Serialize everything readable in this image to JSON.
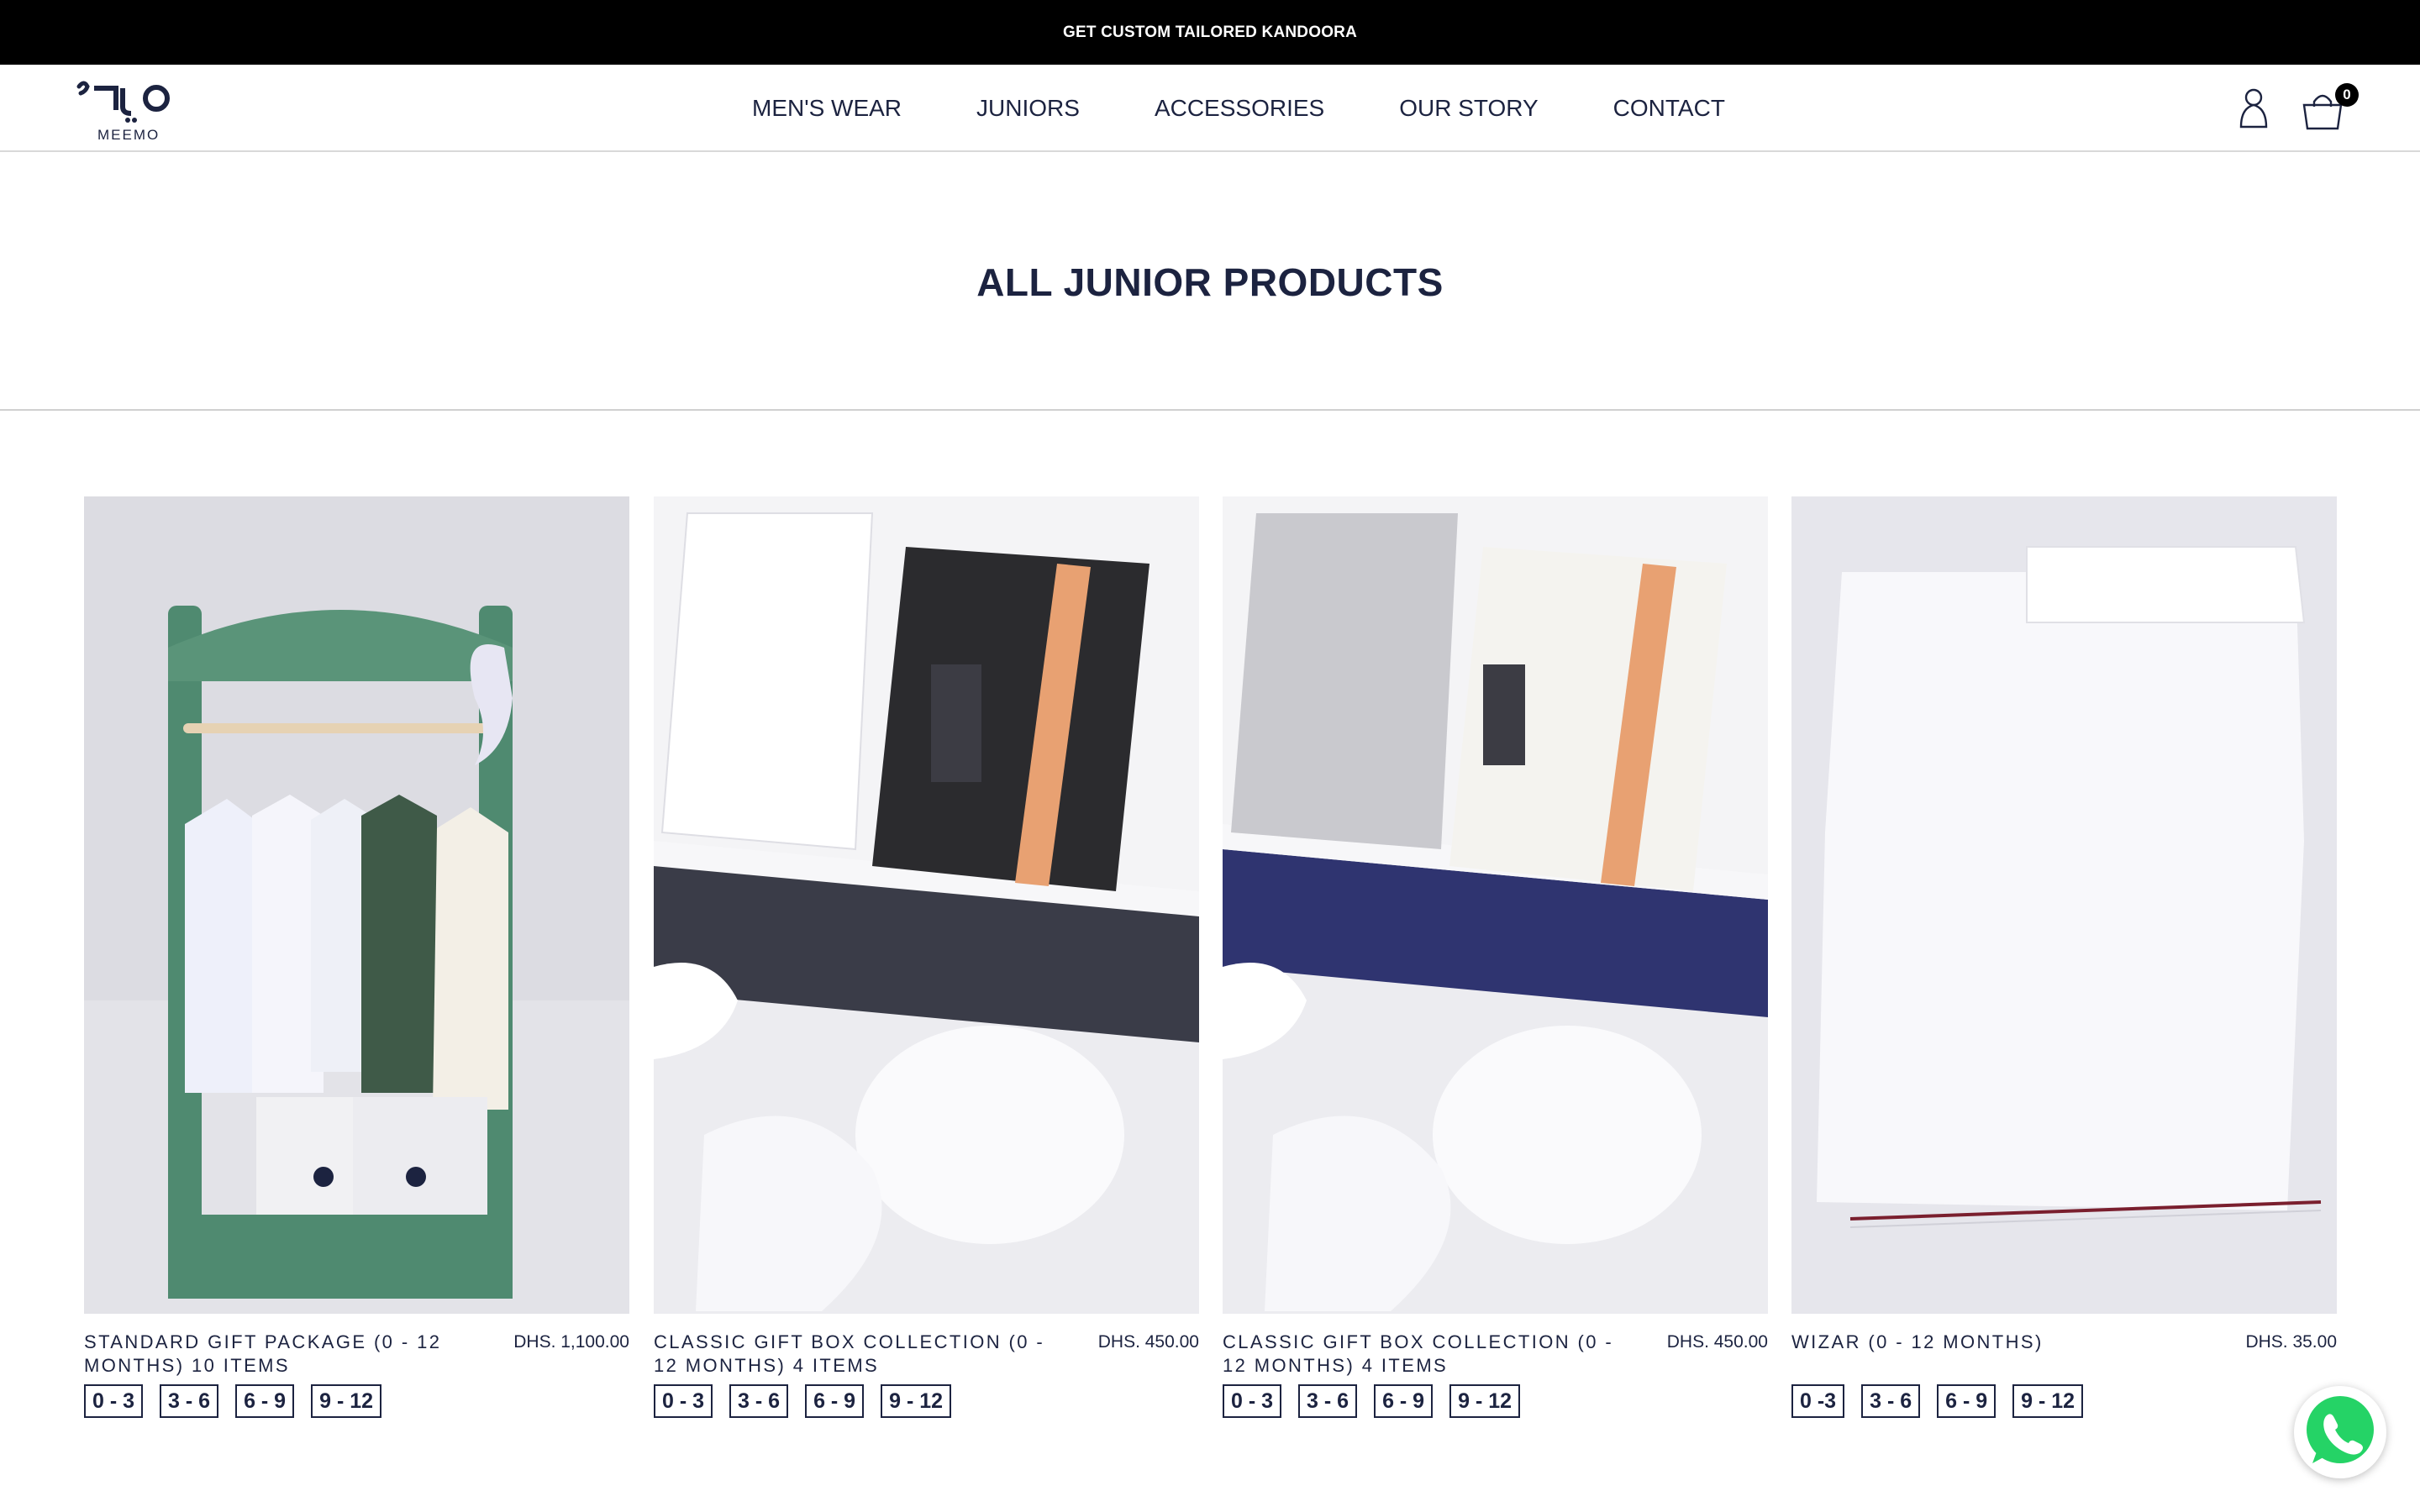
{
  "announcement": {
    "text": "GET CUSTOM TAILORED KANDOORA"
  },
  "header": {
    "logo_text": "MEEMO",
    "nav": [
      "MEN'S WEAR",
      "JUNIORS",
      "ACCESSORIES",
      "OUR STORY",
      "CONTACT"
    ],
    "cart_count": "0",
    "icons": {
      "account": "user-icon",
      "cart": "shopping-bag-icon"
    }
  },
  "page": {
    "title": "ALL JUNIOR PRODUCTS"
  },
  "products": [
    {
      "name": "STANDARD GIFT PACKAGE (0 - 12 MONTHS) 10 ITEMS",
      "price": "DHS. 1,100.00",
      "sizes": [
        "0 - 3",
        "3 - 6",
        "6 - 9",
        "9 - 12"
      ]
    },
    {
      "name": "CLASSIC GIFT BOX COLLECTION (0 - 12 MONTHS) 4 ITEMS",
      "price": "DHS. 450.00",
      "sizes": [
        "0 - 3",
        "3 - 6",
        "6 - 9",
        "9 - 12"
      ]
    },
    {
      "name": "CLASSIC GIFT BOX COLLECTION (0 - 12 MONTHS) 4 ITEMS",
      "price": "DHS. 450.00",
      "sizes": [
        "0 - 3",
        "3 - 6",
        "6 - 9",
        "9 - 12"
      ]
    },
    {
      "name": "WIZAR (0 - 12 MONTHS)",
      "price": "DHS. 35.00",
      "sizes": [
        "0 -3",
        "3 - 6",
        "6 - 9",
        "9 - 12"
      ]
    }
  ],
  "floating": {
    "whatsapp_icon": "whatsapp-icon"
  },
  "colors": {
    "brand_navy": "#1c2340",
    "announcement_bg": "#000000",
    "whatsapp_green": "#25d366"
  }
}
